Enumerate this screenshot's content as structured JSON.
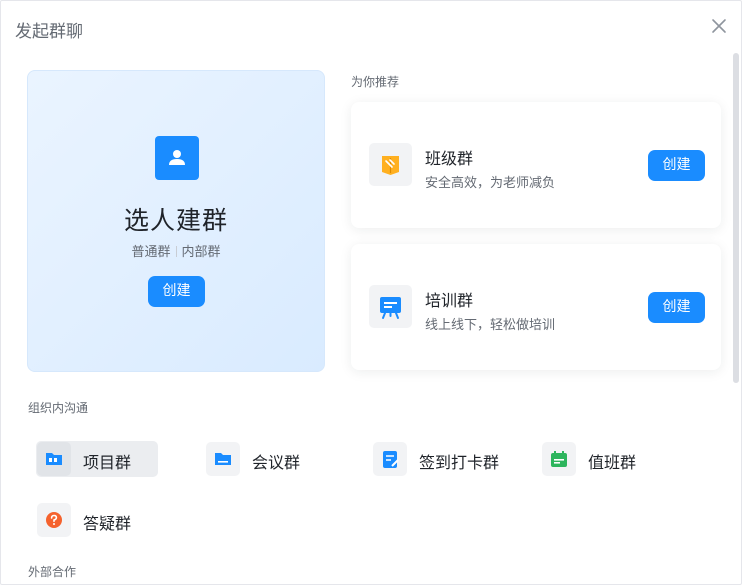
{
  "dialog": {
    "title": "发起群聊"
  },
  "hero": {
    "title": "选人建群",
    "tag1": "普通群",
    "tag2": "内部群",
    "button": "创建"
  },
  "recommend": {
    "label": "为你推荐",
    "cards": [
      {
        "title": "班级群",
        "subtitle": "安全高效，为老师减负",
        "button": "创建",
        "icon": "book-icon"
      },
      {
        "title": "培训群",
        "subtitle": "线上线下，轻松做培训",
        "button": "创建",
        "icon": "presentation-board-icon"
      }
    ]
  },
  "org": {
    "label": "组织内沟通",
    "items": [
      {
        "label": "项目群",
        "icon": "project-folder-icon",
        "active": true
      },
      {
        "label": "会议群",
        "icon": "meeting-folder-icon"
      },
      {
        "label": "签到打卡群",
        "icon": "check-in-icon"
      },
      {
        "label": "值班群",
        "icon": "duty-calendar-icon"
      },
      {
        "label": "答疑群",
        "icon": "question-icon"
      }
    ]
  },
  "external": {
    "label": "外部合作"
  },
  "colors": {
    "accent": "#1a8cff",
    "book": "#ffb020",
    "duty": "#2db55d",
    "question": "#f5622d"
  }
}
